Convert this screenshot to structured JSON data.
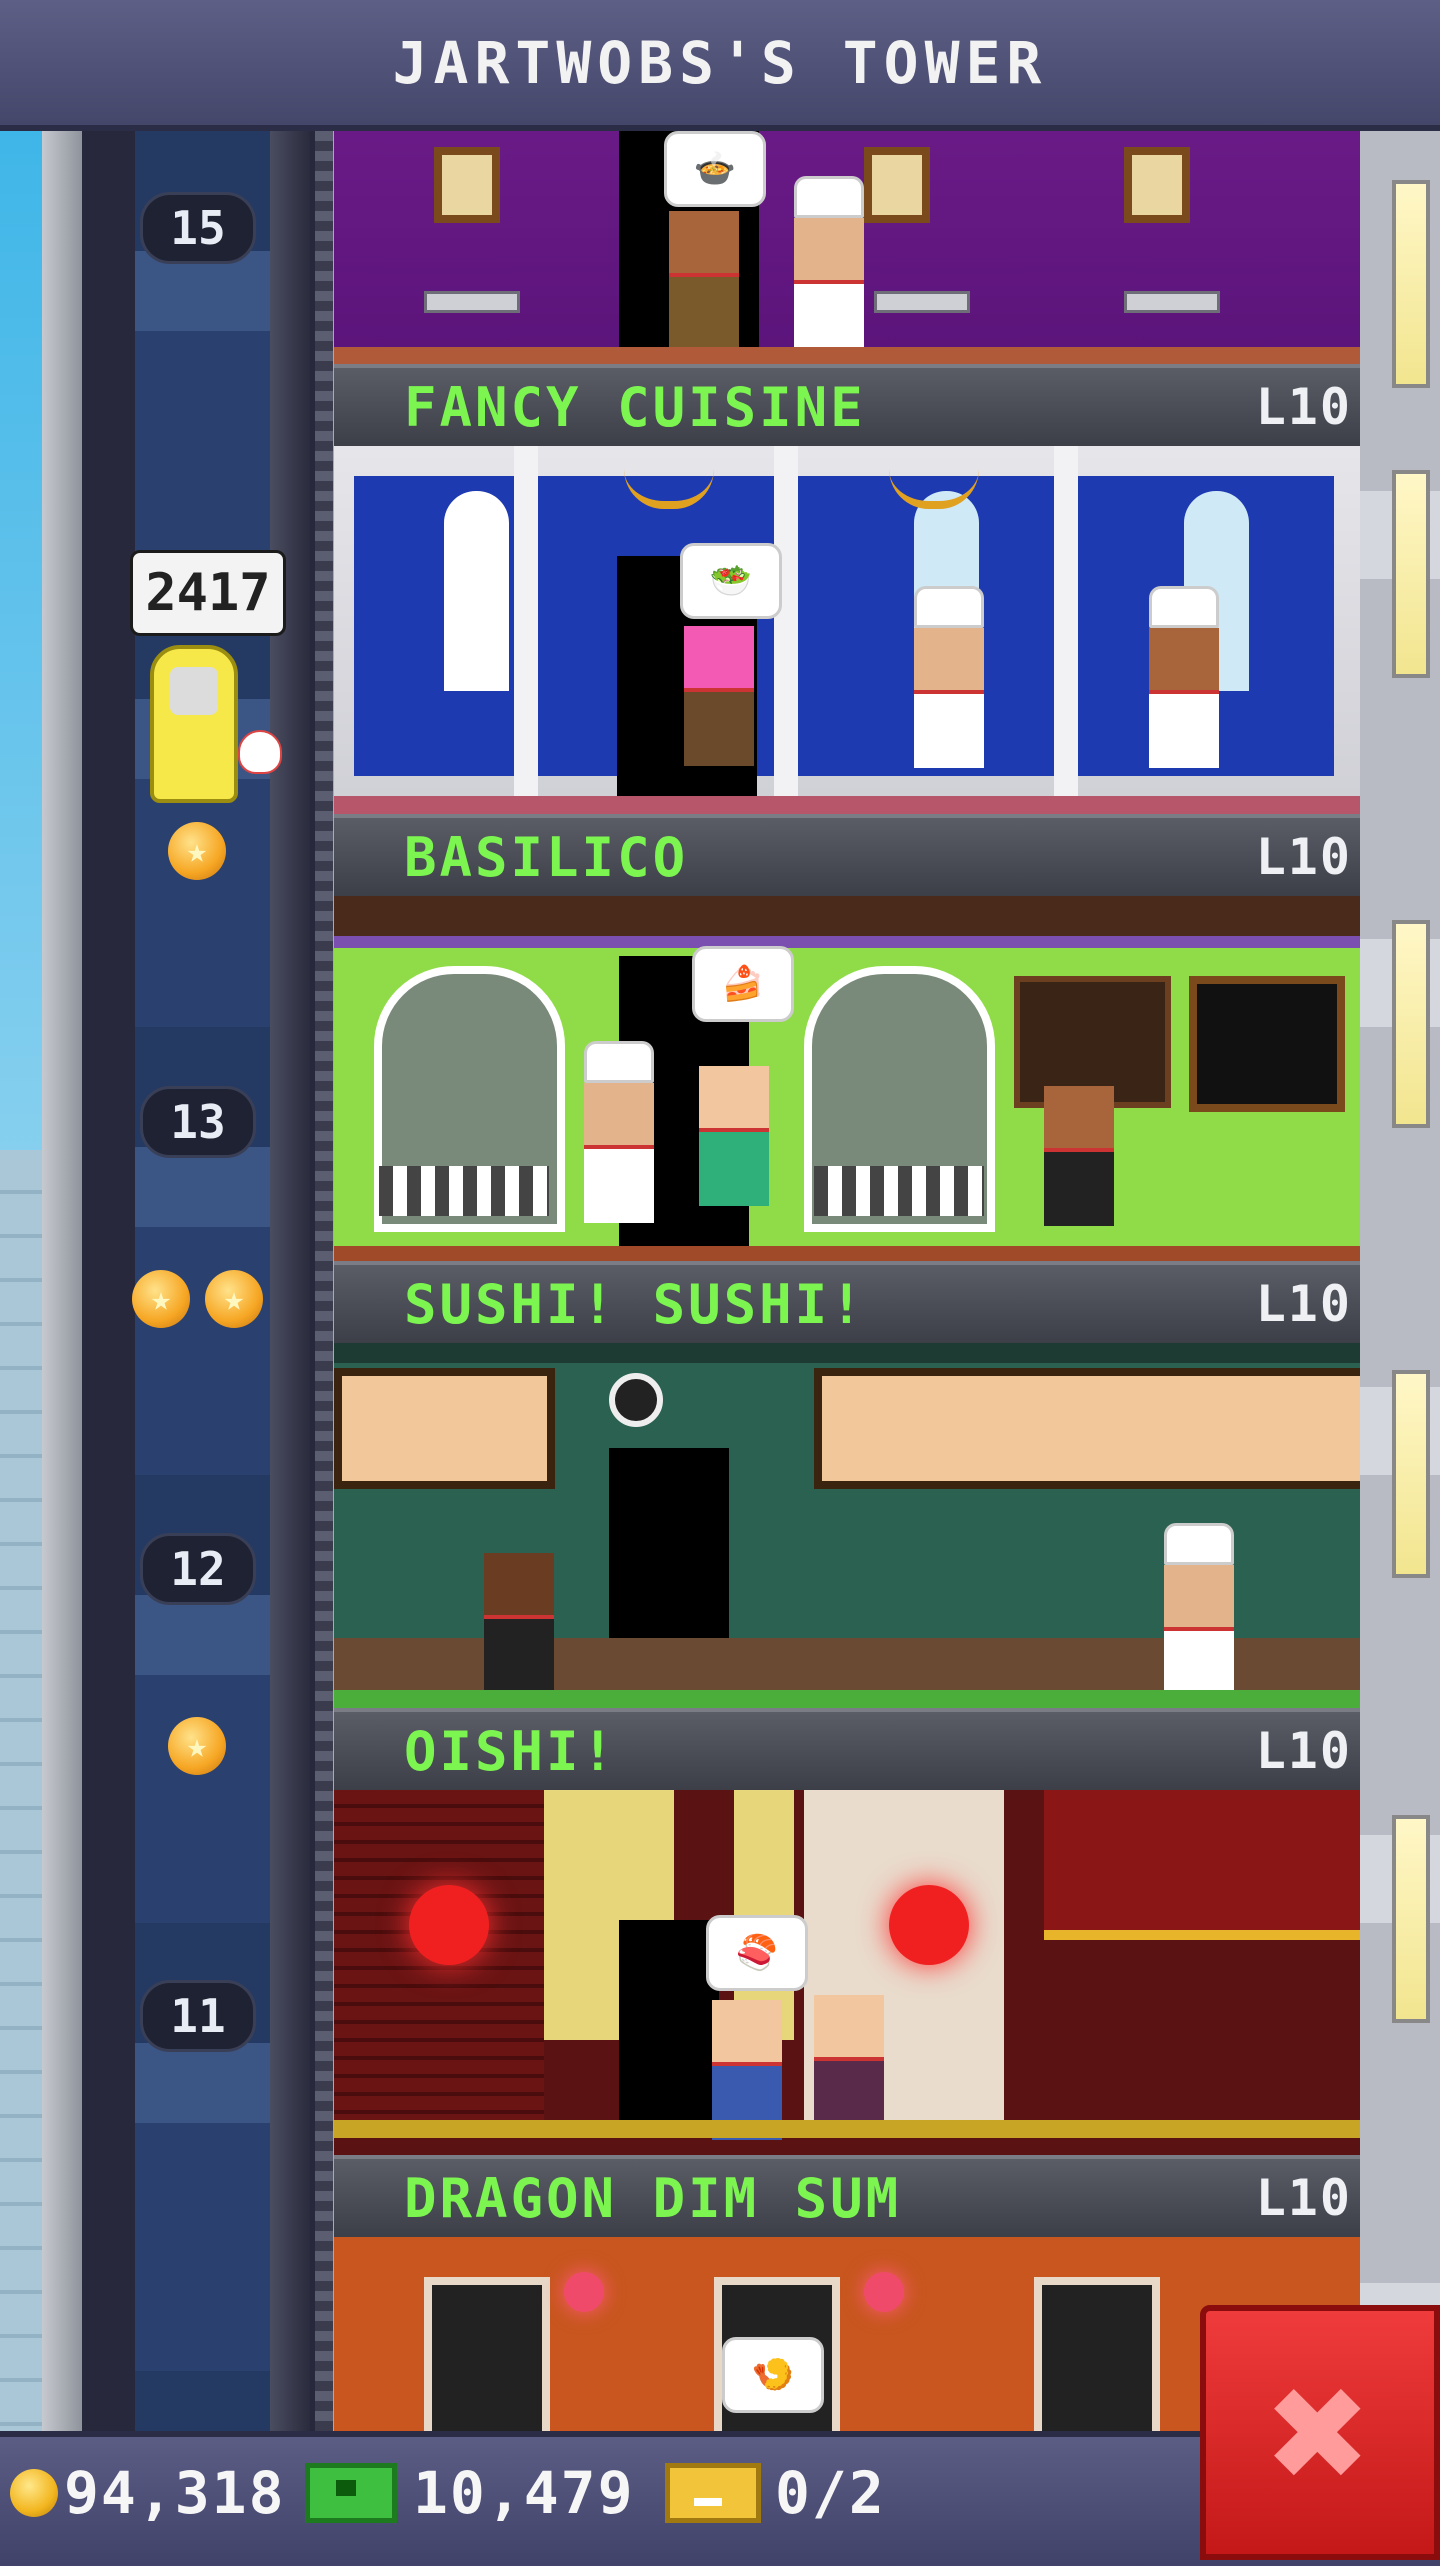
{
  "header": {
    "title": "JARTWOBS'S TOWER"
  },
  "elevator": {
    "rider_count": "2417",
    "floor_numbers": [
      "15",
      "13",
      "12",
      "11"
    ]
  },
  "floors": [
    {
      "name": "FANCY CUISINE",
      "level": "L10"
    },
    {
      "name": "BASILICO",
      "level": "L10"
    },
    {
      "name": "SUSHI! SUSHI!",
      "level": "L10"
    },
    {
      "name": "OISHI!",
      "level": "L10"
    },
    {
      "name": "DRAGON DIM SUM",
      "level": "L10"
    }
  ],
  "footer": {
    "coins": "94,318",
    "bux": "10,479",
    "tickets": "0/2"
  },
  "colors": {
    "label_text": "#7cf550",
    "close_button": "#e02424"
  }
}
